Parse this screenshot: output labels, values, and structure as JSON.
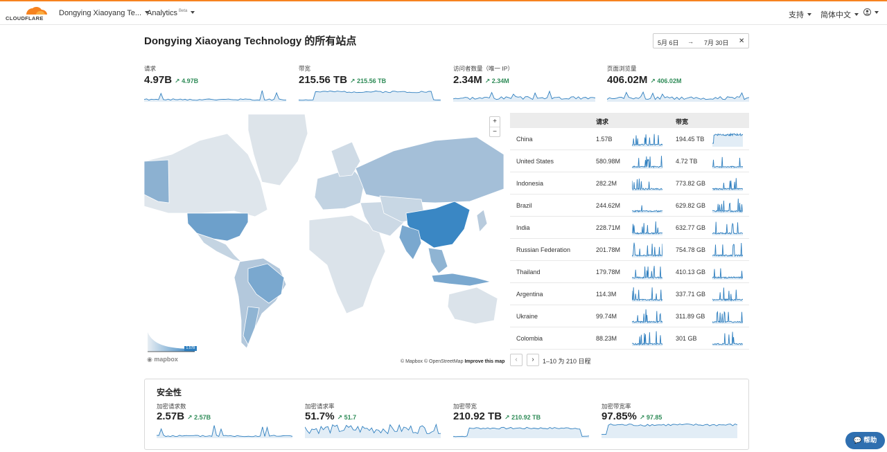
{
  "nav": {
    "logo_text": "CLOUDFLARE",
    "account": "Dongying Xiaoyang Te...",
    "analytics": "Analytics",
    "analytics_badge": "Beta",
    "support": "支持",
    "language": "简体中文"
  },
  "page": {
    "title": "Dongying Xiaoyang Technology 的所有站点",
    "date_from": "5月 6日",
    "date_arrow": "→",
    "date_to": "7月 30日",
    "date_clear": "✕"
  },
  "stats": [
    {
      "label": "请求",
      "value": "4.97B",
      "delta": "↗ 4.97B"
    },
    {
      "label": "带宽",
      "value": "215.56 TB",
      "delta": "↗ 215.56 TB"
    },
    {
      "label": "访问者数量（唯一 IP）",
      "value": "2.34M",
      "delta": "↗ 2.34M"
    },
    {
      "label": "页面浏览量",
      "value": "406.02M",
      "delta": "↗ 406.02M"
    }
  ],
  "map": {
    "zoom_in": "+",
    "zoom_out": "−",
    "legend_max": "1.57B",
    "mapbox": "mapbox",
    "attribution": "© Mapbox © OpenStreetMap",
    "improve": "Improve this map"
  },
  "table": {
    "col_requests": "请求",
    "col_bandwidth": "带宽",
    "rows": [
      {
        "country": "China",
        "requests": "1.57B",
        "bandwidth": "194.45 TB"
      },
      {
        "country": "United States",
        "requests": "580.98M",
        "bandwidth": "4.72 TB"
      },
      {
        "country": "Indonesia",
        "requests": "282.2M",
        "bandwidth": "773.82 GB"
      },
      {
        "country": "Brazil",
        "requests": "244.62M",
        "bandwidth": "629.82 GB"
      },
      {
        "country": "India",
        "requests": "228.71M",
        "bandwidth": "632.77 GB"
      },
      {
        "country": "Russian Federation",
        "requests": "201.78M",
        "bandwidth": "754.78 GB"
      },
      {
        "country": "Thailand",
        "requests": "179.78M",
        "bandwidth": "410.13 GB"
      },
      {
        "country": "Argentina",
        "requests": "114.3M",
        "bandwidth": "337.71 GB"
      },
      {
        "country": "Ukraine",
        "requests": "99.74M",
        "bandwidth": "311.89 GB"
      },
      {
        "country": "Colombia",
        "requests": "88.23M",
        "bandwidth": "301 GB"
      }
    ],
    "pager_prev": "‹",
    "pager_next": "›",
    "pager_text": "1–10 为 210 日程"
  },
  "security": {
    "title": "安全性",
    "stats": [
      {
        "label": "加密请求数",
        "value": "2.57B",
        "delta": "↗ 2.57B"
      },
      {
        "label": "加密请求率",
        "value": "51.7%",
        "delta": "↗ 51.7"
      },
      {
        "label": "加密带宽",
        "value": "210.92 TB",
        "delta": "↗ 210.92 TB"
      },
      {
        "label": "加密带宽率",
        "value": "97.85%",
        "delta": "↗ 97.85"
      }
    ]
  },
  "help_label": "帮助",
  "colors": {
    "accent": "#f6821f",
    "sparkline": "#2f7fbf",
    "map_high": "#3a87c4",
    "map_low": "#dde4ea",
    "positive": "#2e8b57"
  }
}
